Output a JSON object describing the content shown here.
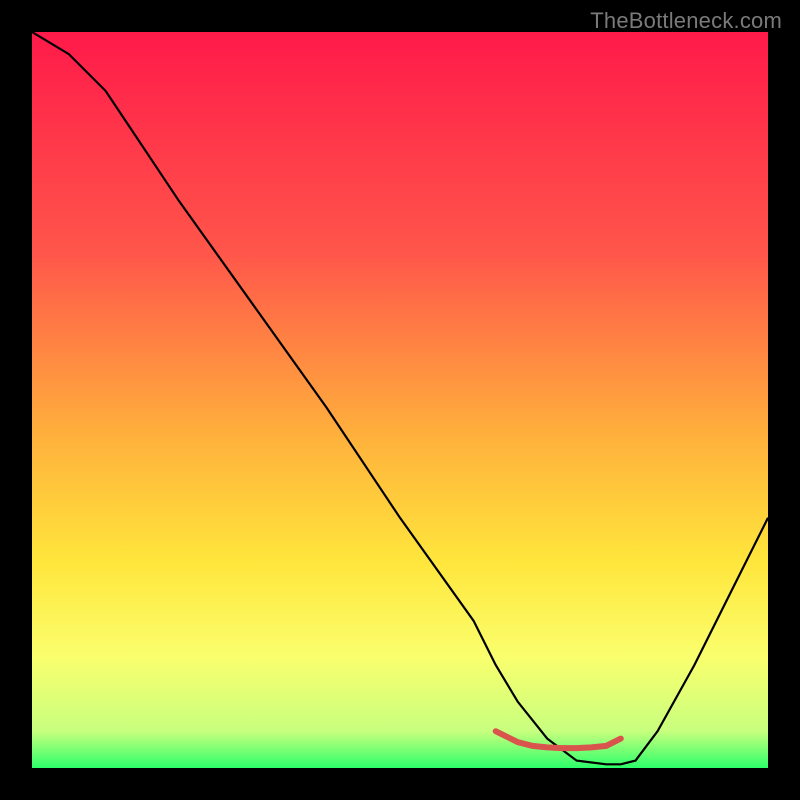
{
  "watermark": "TheBottleneck.com",
  "chart_data": {
    "type": "line",
    "title": "",
    "xlabel": "",
    "ylabel": "",
    "xlim": [
      0,
      100
    ],
    "ylim": [
      0,
      100
    ],
    "gradient": {
      "stops": [
        {
          "offset": 0,
          "color": "#ff1a4a"
        },
        {
          "offset": 30,
          "color": "#ff564a"
        },
        {
          "offset": 55,
          "color": "#ffb13c"
        },
        {
          "offset": 72,
          "color": "#ffe63c"
        },
        {
          "offset": 85,
          "color": "#faff6e"
        },
        {
          "offset": 95,
          "color": "#c8ff7e"
        },
        {
          "offset": 100,
          "color": "#2cff6a"
        }
      ]
    },
    "series": [
      {
        "name": "bottleneck-curve",
        "color": "#000000",
        "x": [
          0,
          5,
          10,
          20,
          30,
          40,
          50,
          60,
          63,
          66,
          70,
          74,
          78,
          80,
          82,
          85,
          90,
          95,
          100
        ],
        "y": [
          100,
          97,
          92,
          77,
          63,
          49,
          34,
          20,
          14,
          9,
          4,
          1,
          0.5,
          0.5,
          1,
          5,
          14,
          24,
          34
        ]
      },
      {
        "name": "optimal-range-marker",
        "color": "#d9544d",
        "x": [
          63,
          66,
          68,
          70,
          72,
          74,
          76,
          78,
          80
        ],
        "y": [
          5,
          3.5,
          3,
          2.8,
          2.7,
          2.7,
          2.8,
          3,
          4
        ]
      }
    ]
  }
}
